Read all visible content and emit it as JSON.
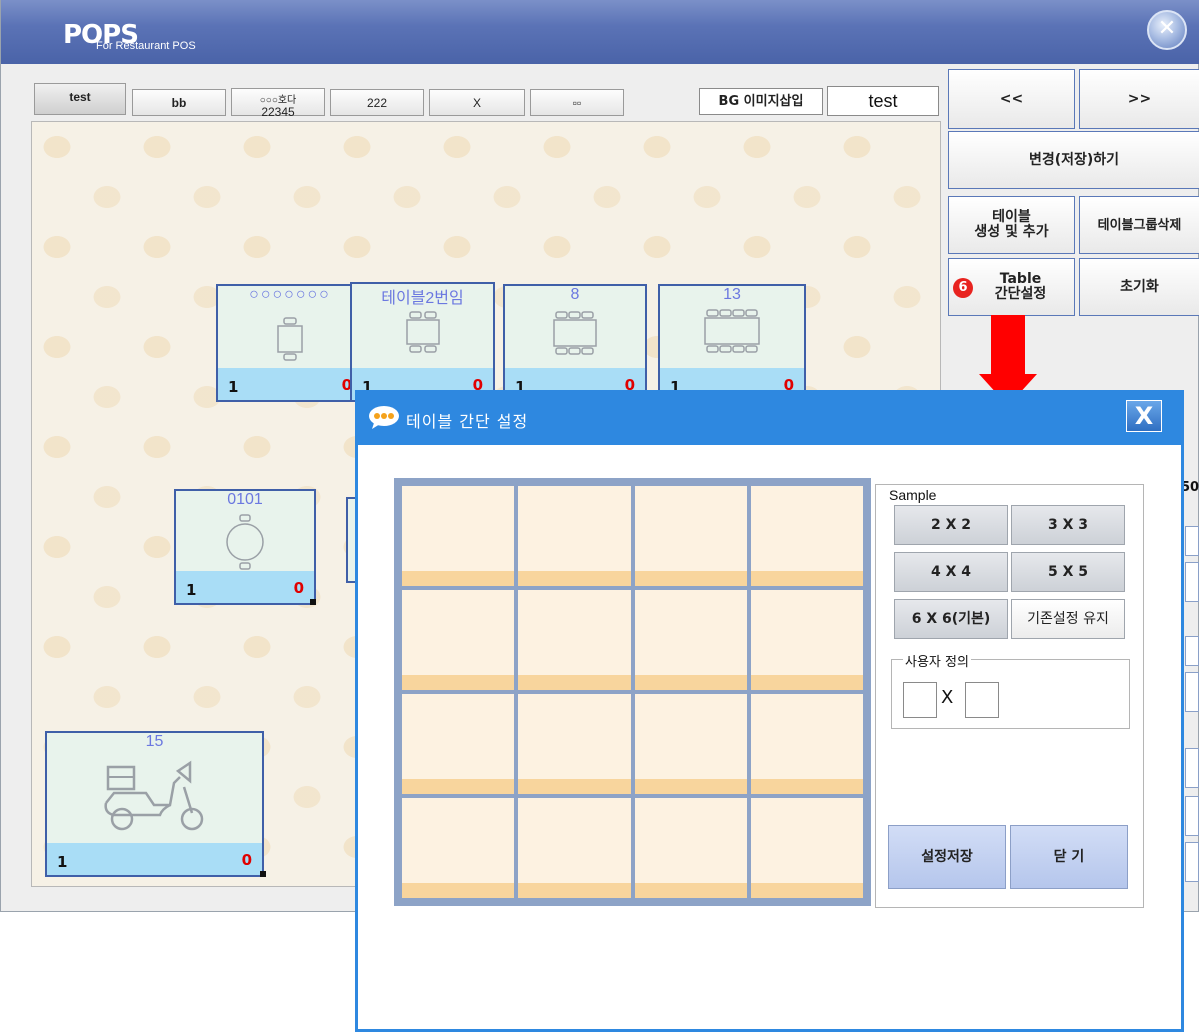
{
  "app": {
    "logo": "POPS",
    "logo_sub": "For Restaurant POS",
    "close_icon": "close-icon"
  },
  "tabs": [
    {
      "line1": "test",
      "line2": ""
    },
    {
      "line1": "bb",
      "line2": ""
    },
    {
      "line1": "○○○호다",
      "line2": "22345"
    },
    {
      "line1": "222",
      "line2": ""
    },
    {
      "line1": "X",
      "line2": ""
    },
    {
      "line1": "▫▫",
      "line2": ""
    }
  ],
  "toolbar": {
    "bg_insert": "BG 이미지삽입",
    "bg_name": "test"
  },
  "commands": {
    "prev": "<<",
    "next": ">>",
    "save_changes": "변경(저장)하기",
    "create_table_l1": "테이블",
    "create_table_l2": "생성 및 추가",
    "delete_group": "테이블그룹삭제",
    "step_badge": "6",
    "table_setup_l1": "Table",
    "table_setup_l2": "간단설정",
    "reset": "초기화",
    "fragment_text": "50"
  },
  "tables": [
    {
      "name": "○○○○○○○",
      "left": "1",
      "right": "0",
      "icon": "two-seat-table-icon"
    },
    {
      "name": "테이블2번임",
      "left": "1",
      "right": "0",
      "icon": "four-seat-table-icon"
    },
    {
      "name": "8",
      "left": "1",
      "right": "0",
      "icon": "six-seat-table-icon"
    },
    {
      "name": "13",
      "left": "1",
      "right": "0",
      "icon": "eight-seat-table-icon"
    },
    {
      "name": "0101",
      "left": "1",
      "right": "0",
      "icon": "round-table-icon"
    },
    {
      "name": "15",
      "left": "1",
      "right": "0",
      "icon": "delivery-scooter-icon"
    }
  ],
  "dialog": {
    "title": "테이블 간단 설정",
    "title_icon": "chat-bubble-icon",
    "close_label": "X",
    "sample_legend": "Sample",
    "samples": [
      "2 X 2",
      "3 X 3",
      "4 X 4",
      "5 X 5",
      "6 X 6(기본)",
      "기존설정 유지"
    ],
    "user_legend": "사용자 정의",
    "user_x": "X",
    "user_rows": "",
    "user_cols": "",
    "save_button": "설정저장",
    "close_button": "닫 기",
    "grid_rows": 4,
    "grid_cols": 4
  },
  "colors": {
    "title_bar": "#5b73b6",
    "dialog_bar": "#2e88e0",
    "table_border": "#3f5fa8",
    "count_red": "#e00000",
    "arrow": "#ff0000"
  }
}
